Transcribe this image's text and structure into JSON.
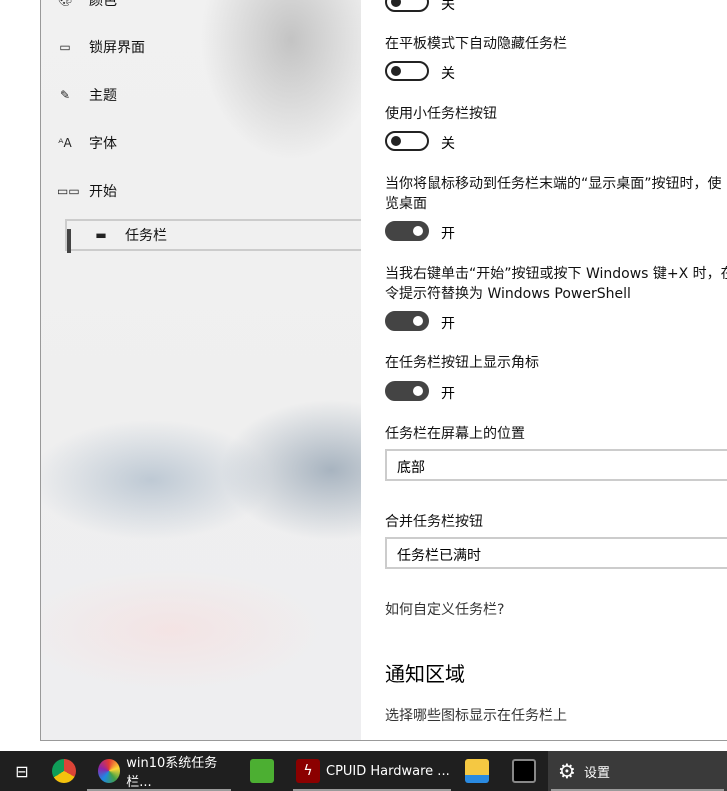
{
  "sidebar": {
    "items": [
      {
        "label": "颜色",
        "icon": "palette-icon"
      },
      {
        "label": "锁屏界面",
        "icon": "lock-screen-icon"
      },
      {
        "label": "主题",
        "icon": "theme-icon"
      },
      {
        "label": "字体",
        "icon": "font-icon"
      },
      {
        "label": "开始",
        "icon": "start-icon"
      },
      {
        "label": "任务栏",
        "icon": "taskbar-icon",
        "selected": true
      }
    ]
  },
  "settings": {
    "top_toggle_state": "关",
    "items": [
      {
        "label": "在平板模式下自动隐藏任务栏",
        "state": "关",
        "on": false
      },
      {
        "label": "使用小任务栏按钮",
        "state": "关",
        "on": false
      },
      {
        "label_line1": "当你将鼠标移动到任务栏末端的“显示桌面”按钮时，使",
        "label_line2": "览桌面",
        "state": "开",
        "on": true
      },
      {
        "label_line1": "当我右键单击“开始”按钮或按下 Windows 键+X 时，在",
        "label_line2": "令提示符替换为 Windows PowerShell",
        "state": "开",
        "on": true
      },
      {
        "label": "在任务栏按钮上显示角标",
        "state": "开",
        "on": true
      }
    ],
    "position_label": "任务栏在屏幕上的位置",
    "position_value": "底部",
    "combine_label": "合并任务栏按钮",
    "combine_value": "任务栏已满时",
    "help_link": "如何自定义任务栏?",
    "notify_heading": "通知区域",
    "notify_link": "选择哪些图标显示在任务栏上"
  },
  "taskbar": {
    "items": [
      {
        "icon": "task-view-icon"
      },
      {
        "icon": "chrome-icon"
      },
      {
        "icon": "photos-icon",
        "label": "win10系统任务栏..."
      },
      {
        "icon": "evernote-icon"
      },
      {
        "icon": "cpuid-icon",
        "label": "CPUID Hardware ..."
      },
      {
        "icon": "file-explorer-icon"
      },
      {
        "icon": "chip-app-icon"
      },
      {
        "icon": "gear-icon",
        "label": "设置"
      }
    ]
  }
}
